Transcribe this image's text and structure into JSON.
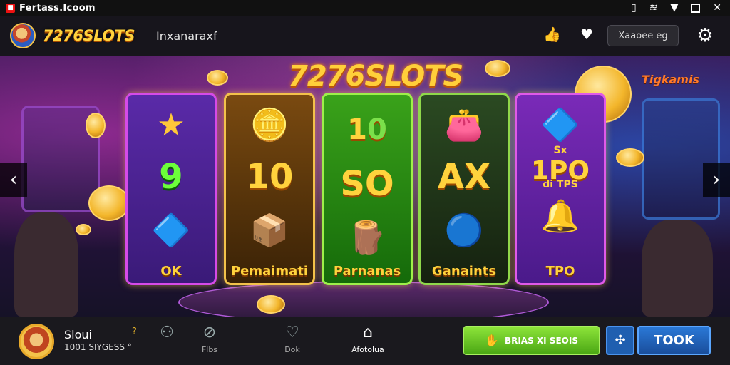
{
  "status_bar": {
    "title": "Fertass.Icoom",
    "icons": [
      "phone-icon",
      "wifi-icon",
      "signal-icon",
      "window-square-icon",
      "close-icon"
    ]
  },
  "header": {
    "logo": "7276SLOTS",
    "nav_label": "Inxanaraxf",
    "button_label": "Xaaoee eg",
    "icons": [
      "thumbs-up-icon",
      "heart-gift-icon",
      "gear-icon"
    ]
  },
  "banner": {
    "title": "7276SLOTS",
    "corner_tag": "Tigkamis",
    "reels": [
      {
        "top_symbol": "★",
        "middle": "9",
        "bottom_symbol": "🔷",
        "label": "OK",
        "color": "#4a1e8c"
      },
      {
        "top_symbol": "🪙",
        "middle": "10",
        "bottom_symbol": "📦",
        "label": "Pemaimati",
        "color": "#5a3206"
      },
      {
        "top_symbol": "",
        "middle": "10",
        "middle_top": "SO",
        "bottom_symbol": "🪵",
        "label": "Parnanas",
        "color": "#1f6a12"
      },
      {
        "top_symbol": "👛",
        "middle": "AX",
        "bottom_symbol": "🔵",
        "label": "Ganaints",
        "color": "#1f3a1a"
      },
      {
        "top_symbol": "🔷",
        "middle": "1PO",
        "middle_sub": "di TPS",
        "middle_top": "Sx",
        "bottom_symbol": "🔔",
        "label": "TPO",
        "color": "#5a1f8c"
      }
    ]
  },
  "bottom_bar": {
    "user_name": "Sloui",
    "balance": "1001 SIYGESS °",
    "coin_symbol": "?",
    "nav": [
      {
        "icon": "cart-icon",
        "label": ""
      },
      {
        "icon": "leaf-icon",
        "label": "Flbs"
      },
      {
        "icon": "heart-icon",
        "label": "Dok"
      },
      {
        "icon": "home-icon",
        "label": "Afotolua"
      }
    ],
    "cta_label": "BRIAS XI SEOIS",
    "took_label": "TOOK"
  }
}
